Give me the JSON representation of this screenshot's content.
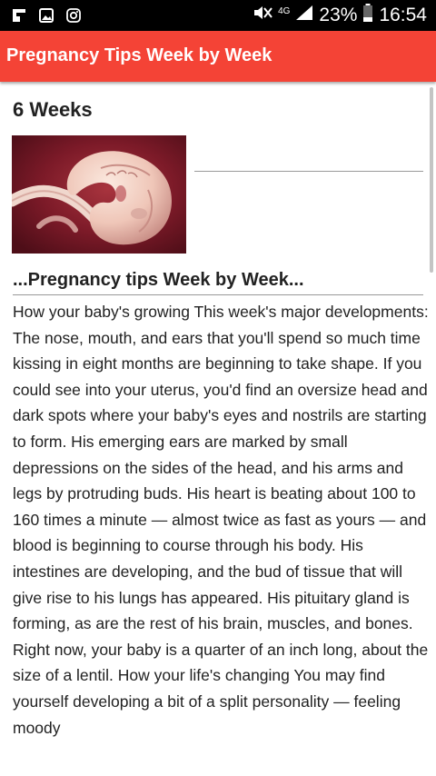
{
  "status_bar": {
    "left_icons": [
      "flipboard-icon",
      "gallery-icon",
      "instagram-icon"
    ],
    "network": "4G",
    "battery": "23%",
    "time": "16:54"
  },
  "app": {
    "title": "Pregnancy Tips Week by Week",
    "bar_color": "#f44336"
  },
  "article": {
    "week_title": "6 Weeks",
    "image_alt": "embryo-image",
    "subheading": "...Pregnancy tips Week by Week...",
    "body": "How your baby's growing This week's major developments: The nose, mouth, and ears that you'll spend so much time kissing in eight months are beginning to take shape. If you could see into your uterus, you'd find an oversize head and dark spots where your baby's eyes and nostrils are starting to form. His emerging ears are marked by small depressions on the sides of the head, and his arms and legs by protruding buds. His heart is beating about 100 to 160 times a minute — almost twice as fast as yours — and blood is beginning to course through his body. His intestines are developing, and the bud of tissue that will give rise to his lungs has appeared. His pituitary gland is forming, as are the rest of his brain, muscles, and bones. Right now, your baby is a quarter of an inch long, about the size of a lentil. How your life's changing You may find yourself developing a bit of a split personality — feeling moody"
  }
}
